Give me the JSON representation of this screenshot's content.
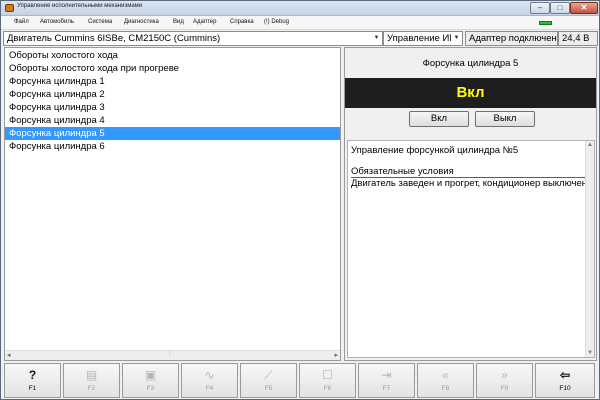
{
  "window": {
    "title": "Управление исполнительными механизмами"
  },
  "menu": [
    "Файл",
    "Автомобиль",
    "Система",
    "Диагностика",
    "Вид",
    "Адаптер",
    "Справка",
    "(!) Debug"
  ],
  "toolbar": {
    "engine": "Двигатель Cummins 6ISBe, CM2150C (Cummins)",
    "mode": "Управление ИМ",
    "adapter_status": "Адаптер подключен",
    "voltage": "24,4 В"
  },
  "list": {
    "items": [
      "Обороты холостого хода",
      "Обороты холостого хода при прогреве",
      "Форсунка цилиндра 1",
      "Форсунка цилиндра 2",
      "Форсунка цилиндра 3",
      "Форсунка цилиндра 4",
      "Форсунка цилиндра 5",
      "Форсунка цилиндра 6"
    ],
    "selected_index": 6
  },
  "detail": {
    "title": "Форсунка цилиндра 5",
    "state": "Вкл",
    "on_label": "Вкл",
    "off_label": "Выкл",
    "heading": "Управление форсункой цилиндра №5",
    "conditions_title": "Обязательные условия",
    "conditions_text": "Двигатель заведен и прогрет, кондиционер выключен"
  },
  "fkeys": [
    {
      "label": "F1",
      "icon": "help-icon",
      "enabled": true
    },
    {
      "label": "F2",
      "icon": "document-icon",
      "enabled": false
    },
    {
      "label": "F3",
      "icon": "save-icon",
      "enabled": false
    },
    {
      "label": "F4",
      "icon": "graph-icon",
      "enabled": false
    },
    {
      "label": "F5",
      "icon": "tool-icon",
      "enabled": false
    },
    {
      "label": "F6",
      "icon": "checkbox-icon",
      "enabled": false
    },
    {
      "label": "F7",
      "icon": "import-icon",
      "enabled": false
    },
    {
      "label": "F8",
      "icon": "back-icon",
      "enabled": false
    },
    {
      "label": "F9",
      "icon": "forward-icon",
      "enabled": false
    },
    {
      "label": "F10",
      "icon": "exit-icon",
      "enabled": true
    }
  ],
  "colors": {
    "selection": "#3399ff",
    "state_bar_bg": "#1e1e1e",
    "state_text": "#ffff00",
    "adapter_led": "#26c42a"
  }
}
